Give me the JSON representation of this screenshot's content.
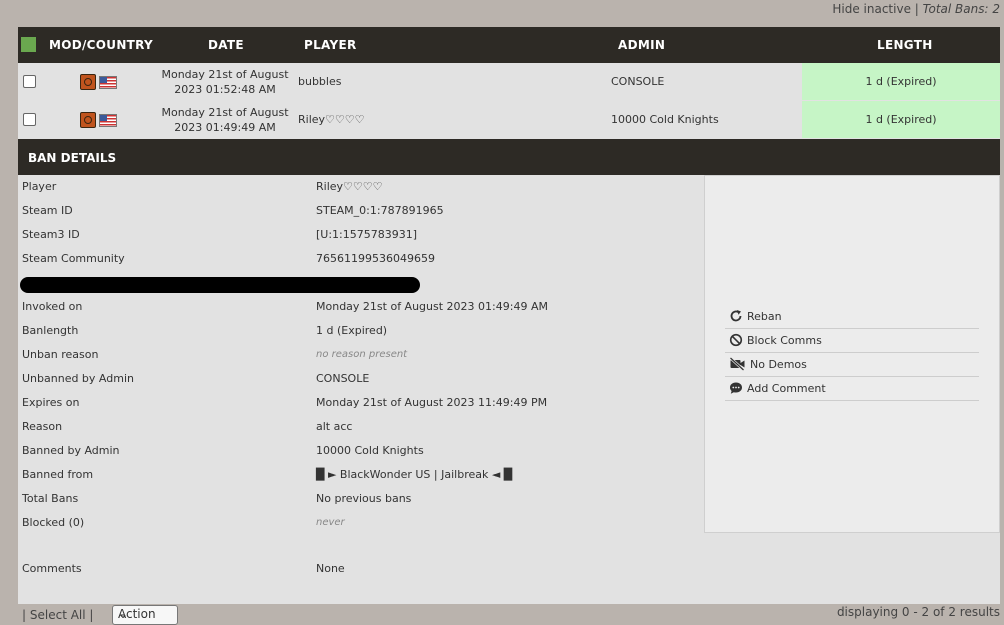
{
  "topbar": {
    "hide_inactive": "Hide inactive",
    "sep": "|",
    "total_bans": "Total Bans: 2"
  },
  "table": {
    "headers": {
      "mod_country": "MOD/COUNTRY",
      "date": "DATE",
      "player": "PLAYER",
      "admin": "ADMIN",
      "length": "LENGTH"
    },
    "rows": [
      {
        "date_line1": "Monday 21st of August",
        "date_line2": "2023 01:52:48 AM",
        "player": "bubbles",
        "admin": "CONSOLE",
        "length": "1 d (Expired)"
      },
      {
        "date_line1": "Monday 21st of August",
        "date_line2": "2023 01:49:49 AM",
        "player": "Riley♡♡♡♡",
        "admin": "10000 Cold Knights",
        "length": "1 d (Expired)"
      }
    ]
  },
  "details": {
    "title": "BAN DETAILS",
    "fields": [
      {
        "label": "Player",
        "value": "Riley♡♡♡♡"
      },
      {
        "label": "Steam ID",
        "value": "STEAM_0:1:787891965"
      },
      {
        "label": "Steam3 ID",
        "value": "[U:1:1575783931]"
      },
      {
        "label": "Steam Community",
        "value": "76561199536049659"
      },
      {
        "label": "Invoked on",
        "value": "Monday 21st of August 2023 01:49:49 AM"
      },
      {
        "label": "Banlength",
        "value": "1 d (Expired)"
      },
      {
        "label": "Unban reason",
        "value": "no reason present"
      },
      {
        "label": "Unbanned by Admin",
        "value": "CONSOLE"
      },
      {
        "label": "Expires on",
        "value": "Monday 21st of August 2023 11:49:49 PM"
      },
      {
        "label": "Reason",
        "value": "alt acc"
      },
      {
        "label": "Banned by Admin",
        "value": "10000 Cold Knights"
      },
      {
        "label": "Banned from",
        "value": "█ ► BlackWonder US | Jailbreak ◄ █"
      },
      {
        "label": "Total Bans",
        "value": "No previous bans"
      },
      {
        "label": "Blocked (0)",
        "value": "never"
      },
      {
        "label": "Comments",
        "value": "None"
      }
    ],
    "actions": [
      {
        "label": "Reban",
        "icon": "reban-icon"
      },
      {
        "label": "Block Comms",
        "icon": "block-icon"
      },
      {
        "label": "No Demos",
        "icon": "no-video-icon"
      },
      {
        "label": "Add Comment",
        "icon": "comment-icon"
      }
    ]
  },
  "footer": {
    "select_all": "Select All",
    "action": "Action",
    "results": "displaying 0 - 2 of 2 results"
  },
  "colors": {
    "header_bg": "#2d2a25",
    "expired_green": "#c6f5c6",
    "checkbox_green": "#6aa84f",
    "panel_bg": "#e2e2e2"
  }
}
